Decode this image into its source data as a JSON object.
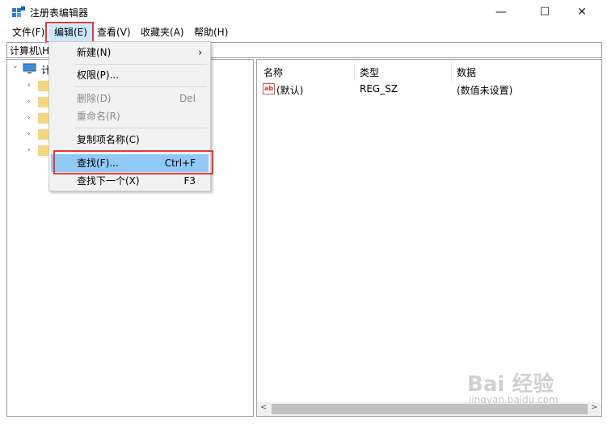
{
  "window": {
    "title": "注册表编辑器",
    "minimize_glyph": "—",
    "maximize_glyph": "☐",
    "close_glyph": "✕",
    "app_icon": "registry-icon"
  },
  "menubar": [
    {
      "label": "文件(F)"
    },
    {
      "label": "编辑(E)"
    },
    {
      "label": "查看(V)"
    },
    {
      "label": "收藏夹(A)"
    },
    {
      "label": "帮助(H)"
    }
  ],
  "address": {
    "text": "计算机\\H"
  },
  "tree": {
    "root_label": "计",
    "expand_glyph": "⌄",
    "collapsed_glyph": "›"
  },
  "list": {
    "columns": [
      "名称",
      "类型",
      "数据"
    ],
    "rows": [
      {
        "icon": "ab-string-icon",
        "icon_text": "ab",
        "name": "(默认)",
        "type": "REG_SZ",
        "data": "(数值未设置)"
      }
    ],
    "scroll_left": "<",
    "scroll_right": ">"
  },
  "edit_menu": {
    "items": [
      {
        "label": "新建(N)",
        "shortcut": "",
        "submenu_arrow": "›",
        "disabled": false
      },
      {
        "label": "权限(P)...",
        "shortcut": "",
        "disabled": false
      },
      {
        "label": "删除(D)",
        "shortcut": "Del",
        "disabled": true
      },
      {
        "label": "重命名(R)",
        "shortcut": "",
        "disabled": true
      },
      {
        "label": "复制项名称(C)",
        "shortcut": "",
        "disabled": false
      },
      {
        "label": "查找(F)...",
        "shortcut": "Ctrl+F",
        "disabled": false,
        "highlighted": true
      },
      {
        "label": "查找下一个(X)",
        "shortcut": "F3",
        "disabled": false
      }
    ]
  },
  "colors": {
    "highlight": "#91c9f7",
    "annotation_red": "#e53935",
    "menu_active": "#cce8ff"
  },
  "watermark": {
    "brand": "Bai 经验",
    "url": "jingyan.baidu.com"
  }
}
